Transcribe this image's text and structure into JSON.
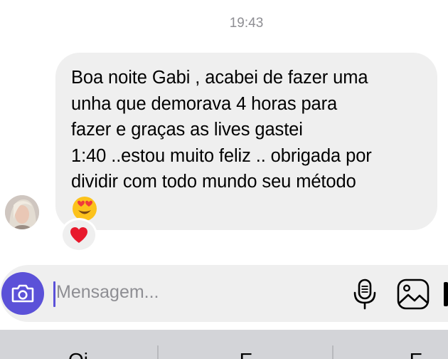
{
  "header": {
    "timestamp": "19:43"
  },
  "message": {
    "lines": [
      "Boa noite Gabi , acabei de fazer uma",
      "unha que demorava 4 horas para",
      "fazer e graças as lives gastei",
      "1:40 ..estou muito feliz .. obrigada por",
      "dividir com todo mundo seu método"
    ],
    "emoji": "smiling-face-with-heart-eyes",
    "reaction": "red-heart"
  },
  "composer": {
    "placeholder": "Mensagem...",
    "accent_color": "#5b51d8"
  },
  "keyboard": {
    "suggestions": [
      "Oi",
      "E",
      "E"
    ]
  }
}
